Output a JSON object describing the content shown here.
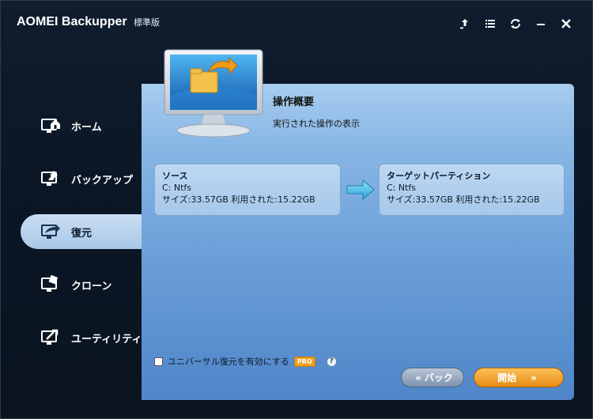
{
  "app": {
    "title": "AOMEI Backupper",
    "edition": "標準版"
  },
  "title_controls": [
    "export-icon",
    "menu-icon",
    "refresh-icon",
    "minimize-icon",
    "close-icon"
  ],
  "sidebar": {
    "items": [
      {
        "label": "ホーム",
        "icon": "home-icon",
        "active": false
      },
      {
        "label": "バックアップ",
        "icon": "backup-icon",
        "active": false
      },
      {
        "label": "復元",
        "icon": "restore-icon",
        "active": true
      },
      {
        "label": "クローン",
        "icon": "clone-icon",
        "active": false
      },
      {
        "label": "ユーティリティ",
        "icon": "tools-icon",
        "active": false
      }
    ]
  },
  "main": {
    "op_title": "操作概要",
    "op_subtitle": "実行された操作の表示",
    "source": {
      "title": "ソース",
      "fs": "C: Ntfs",
      "size": "サイズ:33.57GB 利用された:15.22GB"
    },
    "target": {
      "title": "ターゲットパーティション",
      "fs": "C: Ntfs",
      "size": "サイズ:33.57GB 利用された:15.22GB"
    },
    "universal_restore": {
      "label": "ユニバーサル復元を有効にする",
      "checked": false,
      "badge": "PRO",
      "help": "?"
    },
    "buttons": {
      "back": "バック",
      "start": "開始",
      "back_chev": "«",
      "start_chev": "»"
    }
  },
  "colors": {
    "accent": "#e88c12",
    "panel": "#6b9fd8",
    "active_nav": "#c9ddf2"
  }
}
